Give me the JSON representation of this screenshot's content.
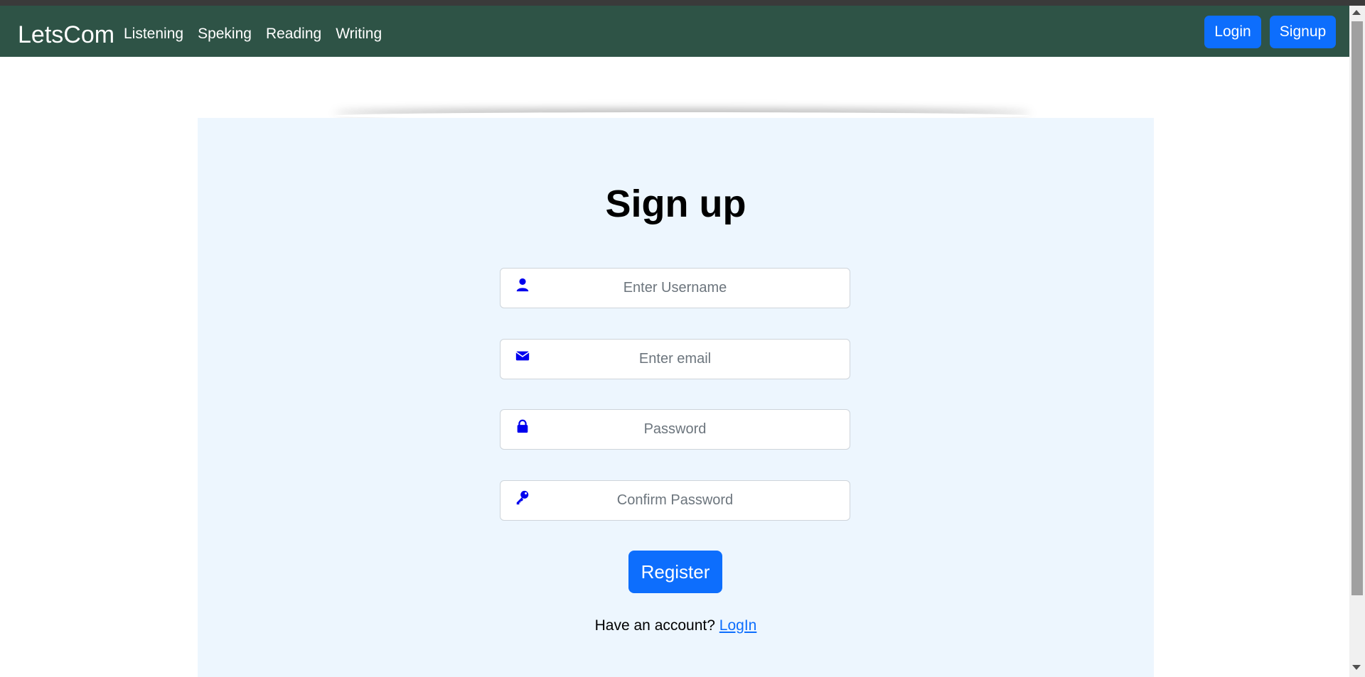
{
  "nav": {
    "brand": "LetsCom",
    "links": [
      "Listening",
      "Speking",
      "Reading",
      "Writing"
    ],
    "login_label": "Login",
    "signup_label": "Signup"
  },
  "form": {
    "title": "Sign up",
    "username": {
      "placeholder": "Enter Username",
      "icon": "user-icon"
    },
    "email": {
      "placeholder": "Enter email",
      "icon": "envelope-icon"
    },
    "password": {
      "placeholder": "Password",
      "icon": "lock-icon"
    },
    "confirm": {
      "placeholder": "Confirm Password",
      "icon": "key-icon"
    },
    "register_label": "Register",
    "account_prompt": "Have an account?",
    "login_link": "LogIn"
  },
  "colors": {
    "navbar_bg": "#2e5346",
    "primary": "#0d6efd",
    "card_bg": "#edf6fe",
    "icon": "#0000ee"
  }
}
